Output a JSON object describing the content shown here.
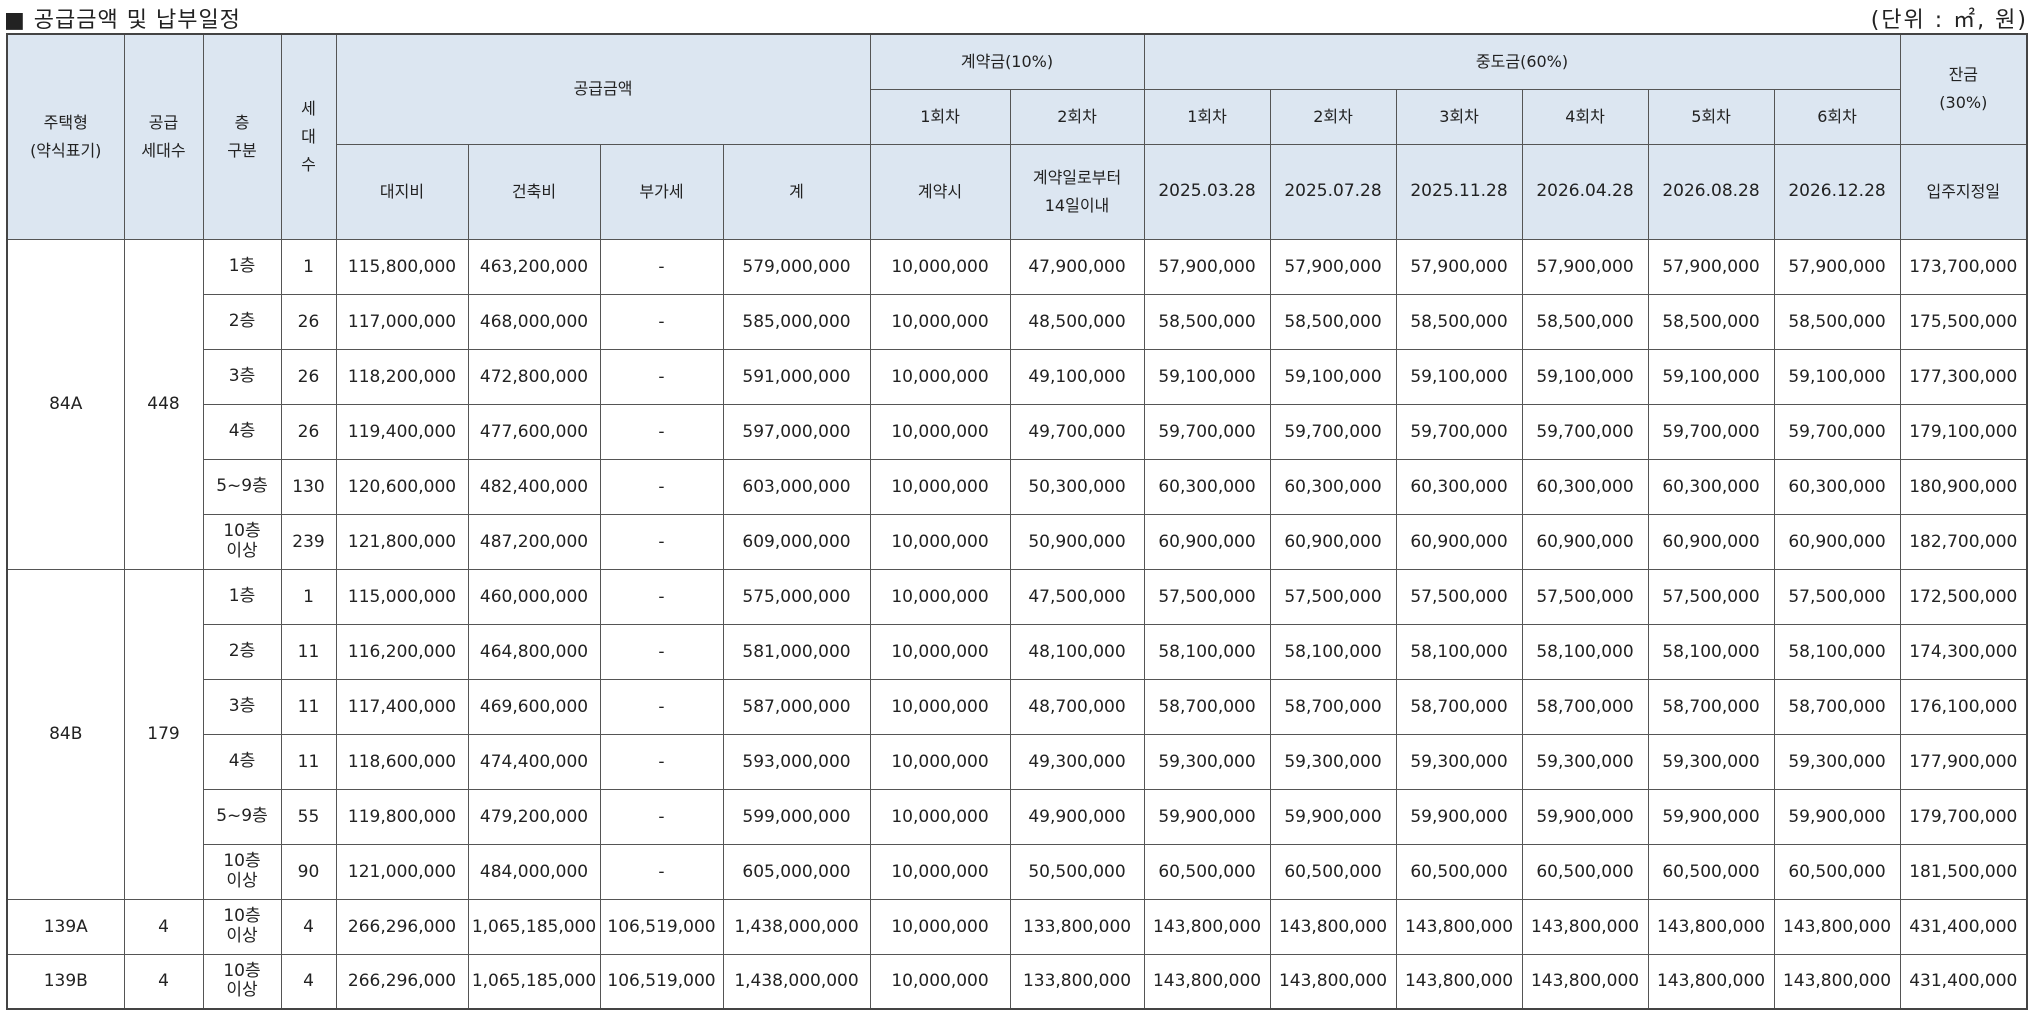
{
  "title": "■ 공급금액 및 납부일정",
  "unit": "(단위 : ㎡, 원)",
  "headers": {
    "type_line1": "주택형",
    "type_line2": "(약식표기)",
    "supply_line1": "공급",
    "supply_line2": "세대수",
    "floor_line1": "층",
    "floor_line2": "구분",
    "hh_1": "세",
    "hh_2": "대",
    "hh_3": "수",
    "price": "공급금액",
    "land": "대지비",
    "build": "건축비",
    "vat": "부가세",
    "total": "계",
    "deposit": "계약금(10%)",
    "dep1": "1회차",
    "dep2": "2회차",
    "dep1_when": "계약시",
    "dep2_when_1": "계약일로부터",
    "dep2_when_2": "14일이내",
    "mid": "중도금(60%)",
    "mid_rounds": [
      "1회차",
      "2회차",
      "3회차",
      "4회차",
      "5회차",
      "6회차"
    ],
    "mid_dates": [
      "2025.03.28",
      "2025.07.28",
      "2025.11.28",
      "2026.04.28",
      "2026.08.28",
      "2026.12.28"
    ],
    "balance_1": "잔금",
    "balance_2": "(30%)",
    "balance_when": "입주지정일"
  },
  "groups": [
    {
      "type": "84A",
      "supply": "448",
      "rows": [
        {
          "floor": "1층",
          "hh": "1",
          "land": "115,800,000",
          "build": "463,200,000",
          "vat": "-",
          "total": "579,000,000",
          "dep1": "10,000,000",
          "dep2": "47,900,000",
          "mid": [
            "57,900,000",
            "57,900,000",
            "57,900,000",
            "57,900,000",
            "57,900,000",
            "57,900,000"
          ],
          "balance": "173,700,000"
        },
        {
          "floor": "2층",
          "hh": "26",
          "land": "117,000,000",
          "build": "468,000,000",
          "vat": "-",
          "total": "585,000,000",
          "dep1": "10,000,000",
          "dep2": "48,500,000",
          "mid": [
            "58,500,000",
            "58,500,000",
            "58,500,000",
            "58,500,000",
            "58,500,000",
            "58,500,000"
          ],
          "balance": "175,500,000"
        },
        {
          "floor": "3층",
          "hh": "26",
          "land": "118,200,000",
          "build": "472,800,000",
          "vat": "-",
          "total": "591,000,000",
          "dep1": "10,000,000",
          "dep2": "49,100,000",
          "mid": [
            "59,100,000",
            "59,100,000",
            "59,100,000",
            "59,100,000",
            "59,100,000",
            "59,100,000"
          ],
          "balance": "177,300,000"
        },
        {
          "floor": "4층",
          "hh": "26",
          "land": "119,400,000",
          "build": "477,600,000",
          "vat": "-",
          "total": "597,000,000",
          "dep1": "10,000,000",
          "dep2": "49,700,000",
          "mid": [
            "59,700,000",
            "59,700,000",
            "59,700,000",
            "59,700,000",
            "59,700,000",
            "59,700,000"
          ],
          "balance": "179,100,000"
        },
        {
          "floor": "5~9층",
          "hh": "130",
          "land": "120,600,000",
          "build": "482,400,000",
          "vat": "-",
          "total": "603,000,000",
          "dep1": "10,000,000",
          "dep2": "50,300,000",
          "mid": [
            "60,300,000",
            "60,300,000",
            "60,300,000",
            "60,300,000",
            "60,300,000",
            "60,300,000"
          ],
          "balance": "180,900,000"
        },
        {
          "floor": "10층|이상",
          "hh": "239",
          "land": "121,800,000",
          "build": "487,200,000",
          "vat": "-",
          "total": "609,000,000",
          "dep1": "10,000,000",
          "dep2": "50,900,000",
          "mid": [
            "60,900,000",
            "60,900,000",
            "60,900,000",
            "60,900,000",
            "60,900,000",
            "60,900,000"
          ],
          "balance": "182,700,000"
        }
      ]
    },
    {
      "type": "84B",
      "supply": "179",
      "rows": [
        {
          "floor": "1층",
          "hh": "1",
          "land": "115,000,000",
          "build": "460,000,000",
          "vat": "-",
          "total": "575,000,000",
          "dep1": "10,000,000",
          "dep2": "47,500,000",
          "mid": [
            "57,500,000",
            "57,500,000",
            "57,500,000",
            "57,500,000",
            "57,500,000",
            "57,500,000"
          ],
          "balance": "172,500,000"
        },
        {
          "floor": "2층",
          "hh": "11",
          "land": "116,200,000",
          "build": "464,800,000",
          "vat": "-",
          "total": "581,000,000",
          "dep1": "10,000,000",
          "dep2": "48,100,000",
          "mid": [
            "58,100,000",
            "58,100,000",
            "58,100,000",
            "58,100,000",
            "58,100,000",
            "58,100,000"
          ],
          "balance": "174,300,000"
        },
        {
          "floor": "3층",
          "hh": "11",
          "land": "117,400,000",
          "build": "469,600,000",
          "vat": "-",
          "total": "587,000,000",
          "dep1": "10,000,000",
          "dep2": "48,700,000",
          "mid": [
            "58,700,000",
            "58,700,000",
            "58,700,000",
            "58,700,000",
            "58,700,000",
            "58,700,000"
          ],
          "balance": "176,100,000"
        },
        {
          "floor": "4층",
          "hh": "11",
          "land": "118,600,000",
          "build": "474,400,000",
          "vat": "-",
          "total": "593,000,000",
          "dep1": "10,000,000",
          "dep2": "49,300,000",
          "mid": [
            "59,300,000",
            "59,300,000",
            "59,300,000",
            "59,300,000",
            "59,300,000",
            "59,300,000"
          ],
          "balance": "177,900,000"
        },
        {
          "floor": "5~9층",
          "hh": "55",
          "land": "119,800,000",
          "build": "479,200,000",
          "vat": "-",
          "total": "599,000,000",
          "dep1": "10,000,000",
          "dep2": "49,900,000",
          "mid": [
            "59,900,000",
            "59,900,000",
            "59,900,000",
            "59,900,000",
            "59,900,000",
            "59,900,000"
          ],
          "balance": "179,700,000"
        },
        {
          "floor": "10층|이상",
          "hh": "90",
          "land": "121,000,000",
          "build": "484,000,000",
          "vat": "-",
          "total": "605,000,000",
          "dep1": "10,000,000",
          "dep2": "50,500,000",
          "mid": [
            "60,500,000",
            "60,500,000",
            "60,500,000",
            "60,500,000",
            "60,500,000",
            "60,500,000"
          ],
          "balance": "181,500,000"
        }
      ]
    },
    {
      "type": "139A",
      "supply": "4",
      "rows": [
        {
          "floor": "10층|이상",
          "hh": "4",
          "land": "266,296,000",
          "build": "1,065,185,000",
          "vat": "106,519,000",
          "total": "1,438,000,000",
          "dep1": "10,000,000",
          "dep2": "133,800,000",
          "mid": [
            "143,800,000",
            "143,800,000",
            "143,800,000",
            "143,800,000",
            "143,800,000",
            "143,800,000"
          ],
          "balance": "431,400,000"
        }
      ]
    },
    {
      "type": "139B",
      "supply": "4",
      "rows": [
        {
          "floor": "10층|이상",
          "hh": "4",
          "land": "266,296,000",
          "build": "1,065,185,000",
          "vat": "106,519,000",
          "total": "1,438,000,000",
          "dep1": "10,000,000",
          "dep2": "133,800,000",
          "mid": [
            "143,800,000",
            "143,800,000",
            "143,800,000",
            "143,800,000",
            "143,800,000",
            "143,800,000"
          ],
          "balance": "431,400,000"
        }
      ]
    }
  ]
}
